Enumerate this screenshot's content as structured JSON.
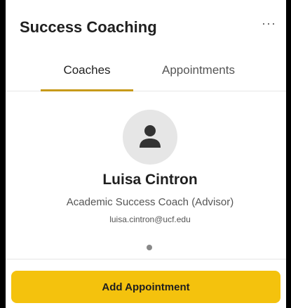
{
  "header": {
    "title": "Success Coaching",
    "more_label": "···"
  },
  "tabs": [
    {
      "label": "Coaches",
      "active": true
    },
    {
      "label": "Appointments",
      "active": false
    }
  ],
  "coach": {
    "name": "Luisa Cintron",
    "role": "Academic Success Coach (Advisor)",
    "email": "luisa.cintron@ucf.edu"
  },
  "actions": {
    "add_appointment_label": "Add Appointment"
  },
  "colors": {
    "accent": "#f4c20d",
    "tab_underline": "#c79a1a"
  }
}
